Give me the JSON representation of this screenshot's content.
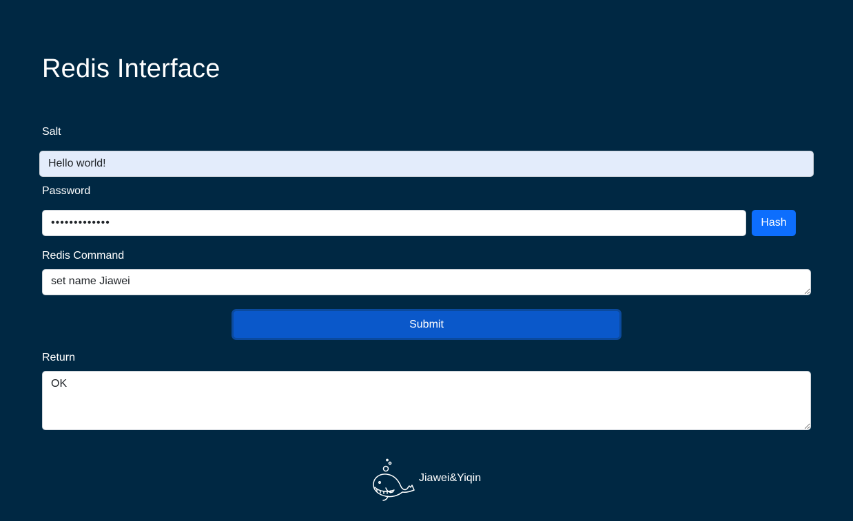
{
  "page": {
    "title": "Redis Interface",
    "background_color": "#002843"
  },
  "form": {
    "salt": {
      "label": "Salt",
      "value": "Hello world!"
    },
    "password": {
      "label": "Password",
      "value": "•••••••••••••"
    },
    "hash_button_label": "Hash",
    "command": {
      "label": "Redis Command",
      "value": "set name Jiawei"
    },
    "submit_button_label": "Submit",
    "return": {
      "label": "Return",
      "value": "OK"
    }
  },
  "footer": {
    "logo_icon": "whale-icon",
    "text": "Jiawei&Yiqin"
  },
  "colors": {
    "primary_button": "#0d6efd",
    "submit_button": "#0a58ca",
    "salt_field_bg": "#e3ecfb"
  }
}
